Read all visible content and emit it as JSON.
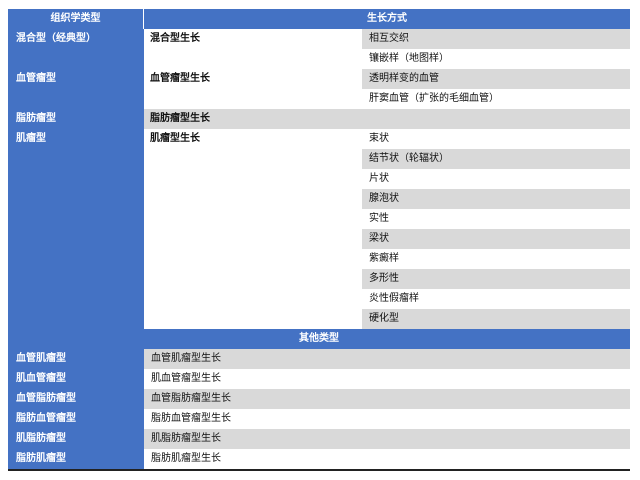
{
  "header": {
    "col1": "组织学类型",
    "col2": "生长方式"
  },
  "main_rows": [
    {
      "type": "混合型（经典型）",
      "growth": "混合型生长",
      "pattern": "相互交织"
    },
    {
      "type": "",
      "growth": "",
      "pattern": "镶嵌样（地图样）"
    },
    {
      "type": "血管瘤型",
      "growth": "血管瘤型生长",
      "pattern": "透明样变的血管"
    },
    {
      "type": "",
      "growth": "",
      "pattern": "肝窦血管（扩张的毛细血管）"
    },
    {
      "type": "脂肪瘤型",
      "growth": "脂肪瘤型生长",
      "pattern": ""
    },
    {
      "type": "肌瘤型",
      "growth": "肌瘤型生长",
      "pattern": "束状"
    },
    {
      "type": "",
      "growth": "",
      "pattern": "结节状（轮辐状）"
    },
    {
      "type": "",
      "growth": "",
      "pattern": "片状"
    },
    {
      "type": "",
      "growth": "",
      "pattern": "腺泡状"
    },
    {
      "type": "",
      "growth": "",
      "pattern": "实性"
    },
    {
      "type": "",
      "growth": "",
      "pattern": "梁状"
    },
    {
      "type": "",
      "growth": "",
      "pattern": "紫癜样"
    },
    {
      "type": "",
      "growth": "",
      "pattern": "多形性"
    },
    {
      "type": "",
      "growth": "",
      "pattern": "炎性假瘤样"
    },
    {
      "type": "",
      "growth": "",
      "pattern": "硬化型"
    }
  ],
  "other_header": "其他类型",
  "other_rows": [
    {
      "type": "血管肌瘤型",
      "growth": "血管肌瘤型生长"
    },
    {
      "type": "肌血管瘤型",
      "growth": "肌血管瘤型生长"
    },
    {
      "type": "血管脂肪瘤型",
      "growth": "血管脂肪瘤型生长"
    },
    {
      "type": "脂肪血管瘤型",
      "growth": "脂肪血管瘤型生长"
    },
    {
      "type": "肌脂肪瘤型",
      "growth": "肌脂肪瘤型生长"
    },
    {
      "type": "脂肪肌瘤型",
      "growth": "脂肪肌瘤型生长"
    }
  ]
}
